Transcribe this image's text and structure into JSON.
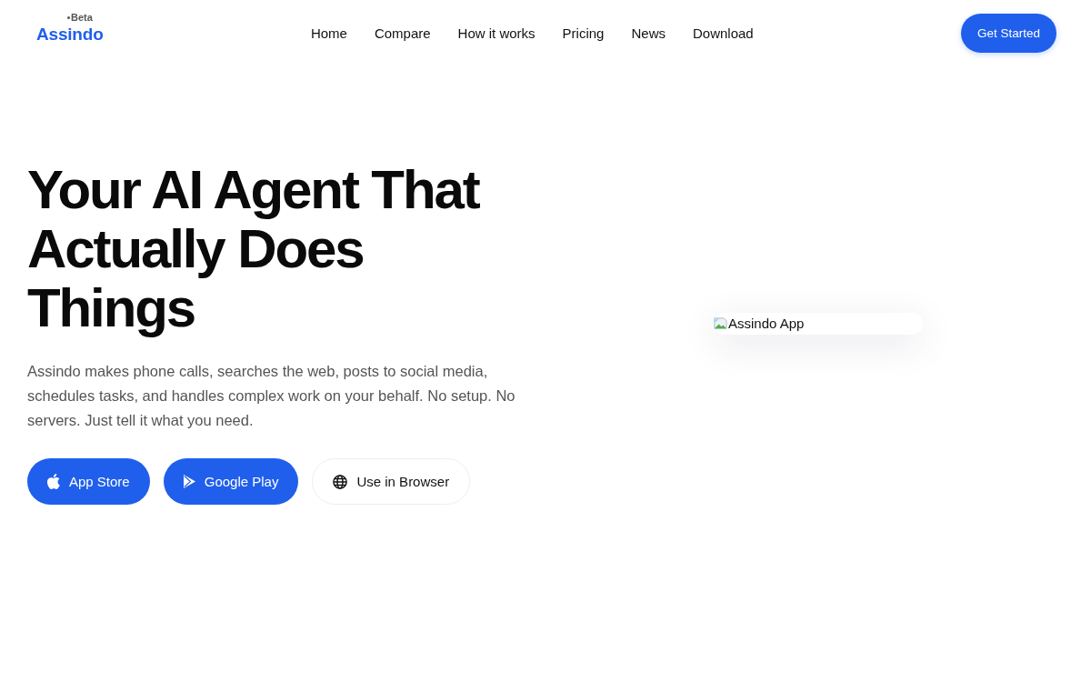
{
  "header": {
    "logo": {
      "name": "Assindo",
      "badge": "Beta"
    },
    "links": [
      "Home",
      "Compare",
      "How it works",
      "Pricing",
      "News",
      "Download"
    ],
    "cta": "Get Started"
  },
  "hero": {
    "title": "Your AI Agent That Actually Does Things",
    "description": "Assindo makes phone calls, searches the web, posts to social media, schedules tasks, and handles complex work on your behalf. No setup. No servers. Just tell it what you need.",
    "buttons": [
      {
        "kind": "apple",
        "label": "App Store"
      },
      {
        "kind": "play",
        "label": "Google Play"
      },
      {
        "kind": "browser",
        "label": "Use in Browser"
      }
    ],
    "image": {
      "alt": "Assindo App"
    }
  }
}
